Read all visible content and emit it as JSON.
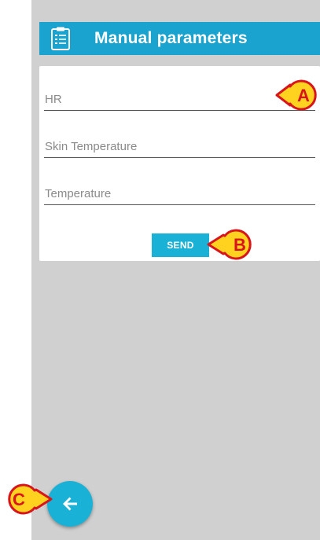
{
  "header": {
    "title": "Manual parameters",
    "icon": "clipboard-checklist-icon"
  },
  "form": {
    "fields": [
      {
        "placeholder": "HR"
      },
      {
        "placeholder": "Skin Temperature"
      },
      {
        "placeholder": "Temperature"
      }
    ],
    "send_label": "SEND"
  },
  "back_button": {
    "icon": "arrow-left-icon"
  },
  "callouts": {
    "a": "A",
    "b": "B",
    "c": "C"
  },
  "colors": {
    "accent": "#1ab1d6",
    "header_bg": "#1aa3cf",
    "background": "#d0d0d0",
    "callout_fill": "#ffd21f",
    "callout_stroke": "#d8141c"
  }
}
